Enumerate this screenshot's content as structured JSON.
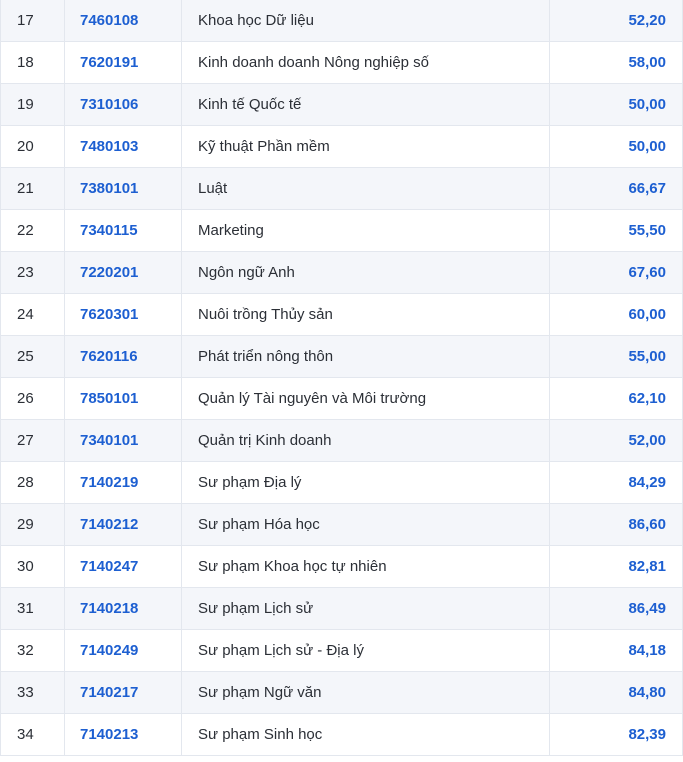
{
  "table": {
    "rows": [
      {
        "stt": "17",
        "code": "7460108",
        "name": "Khoa học Dữ liệu",
        "score": "52,20"
      },
      {
        "stt": "18",
        "code": "7620191",
        "name": "Kinh doanh doanh Nông nghiệp số",
        "score": "58,00"
      },
      {
        "stt": "19",
        "code": "7310106",
        "name": "Kinh tế Quốc tế",
        "score": "50,00"
      },
      {
        "stt": "20",
        "code": "7480103",
        "name": "Kỹ thuật Phần mềm",
        "score": "50,00"
      },
      {
        "stt": "21",
        "code": "7380101",
        "name": "Luật",
        "score": "66,67"
      },
      {
        "stt": "22",
        "code": "7340115",
        "name": "Marketing",
        "score": "55,50"
      },
      {
        "stt": "23",
        "code": "7220201",
        "name": "Ngôn ngữ Anh",
        "score": "67,60"
      },
      {
        "stt": "24",
        "code": "7620301",
        "name": "Nuôi trồng Thủy sản",
        "score": "60,00"
      },
      {
        "stt": "25",
        "code": "7620116",
        "name": "Phát triển nông thôn",
        "score": "55,00"
      },
      {
        "stt": "26",
        "code": "7850101",
        "name": "Quản lý Tài nguyên và Môi trường",
        "score": "62,10"
      },
      {
        "stt": "27",
        "code": "7340101",
        "name": "Quản trị Kinh doanh",
        "score": "52,00"
      },
      {
        "stt": "28",
        "code": "7140219",
        "name": "Sư phạm Địa lý",
        "score": "84,29"
      },
      {
        "stt": "29",
        "code": "7140212",
        "name": "Sư phạm Hóa học",
        "score": "86,60"
      },
      {
        "stt": "30",
        "code": "7140247",
        "name": "Sư phạm Khoa học tự nhiên",
        "score": "82,81"
      },
      {
        "stt": "31",
        "code": "7140218",
        "name": "Sư phạm Lịch sử",
        "score": "86,49"
      },
      {
        "stt": "32",
        "code": "7140249",
        "name": "Sư phạm Lịch sử - Địa lý",
        "score": "84,18"
      },
      {
        "stt": "33",
        "code": "7140217",
        "name": "Sư phạm Ngữ văn",
        "score": "84,80"
      },
      {
        "stt": "34",
        "code": "7140213",
        "name": "Sư phạm Sinh học",
        "score": "82,39"
      }
    ]
  },
  "colors": {
    "accent": "#1d5fd1",
    "text": "#2b2f36",
    "row_alt": "#f4f6fa",
    "border": "#e3e7ee"
  }
}
